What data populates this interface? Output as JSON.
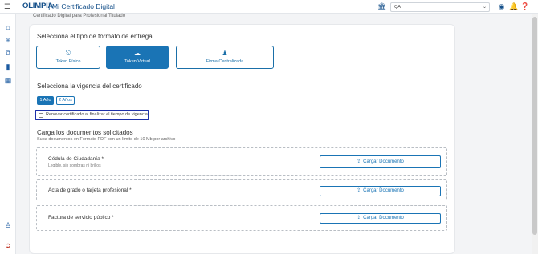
{
  "header": {
    "brand": "OLIMPIA",
    "separator": "|",
    "title": "Mi Certificado Digital",
    "environment": "QA",
    "icons": [
      "building-icon",
      "user-circle-icon",
      "bell-icon",
      "help-icon"
    ]
  },
  "sidebar": {
    "icons": [
      "home-icon",
      "add-circle-icon",
      "copy-icon",
      "folder-icon",
      "document-icon",
      "team-icon",
      "logout-icon"
    ]
  },
  "breadcrumb": "Certificado Digital para Profesional Titulado",
  "format_section": {
    "title": "Selecciona el tipo de formato de entrega",
    "options": [
      {
        "label": "Token Físico",
        "icon": "usb-icon",
        "selected": false
      },
      {
        "label": "Token Virtual",
        "icon": "cloud-icon",
        "selected": true
      },
      {
        "label": "Firma Centralizada",
        "icon": "people-network-icon",
        "selected": false
      }
    ]
  },
  "validity_section": {
    "title": "Selecciona la vigencia del certificado",
    "options": [
      {
        "label": "1 Año",
        "selected": true
      },
      {
        "label": "2 Años",
        "selected": false
      }
    ],
    "renew_label": "Renovar certificado al finalizar el tiempo de vigencia",
    "renew_checked": false
  },
  "documents_section": {
    "title": "Carga los documentos solicitados",
    "subtitle": "Suba documentos en Formato PDF con un límite de 10 Mb por archivo",
    "upload_label": "Cargar Documento",
    "items": [
      {
        "name": "Cédula de Ciudadanía *",
        "hint": "Legible, sin sombras ni brillos"
      },
      {
        "name": "Acta de grado o tarjeta profesional *",
        "hint": ""
      },
      {
        "name": "Factura de servicio público *",
        "hint": ""
      }
    ]
  },
  "colors": {
    "primary": "#1a74b5",
    "brand": "#15508a",
    "highlight_border": "#1c2fa8"
  }
}
